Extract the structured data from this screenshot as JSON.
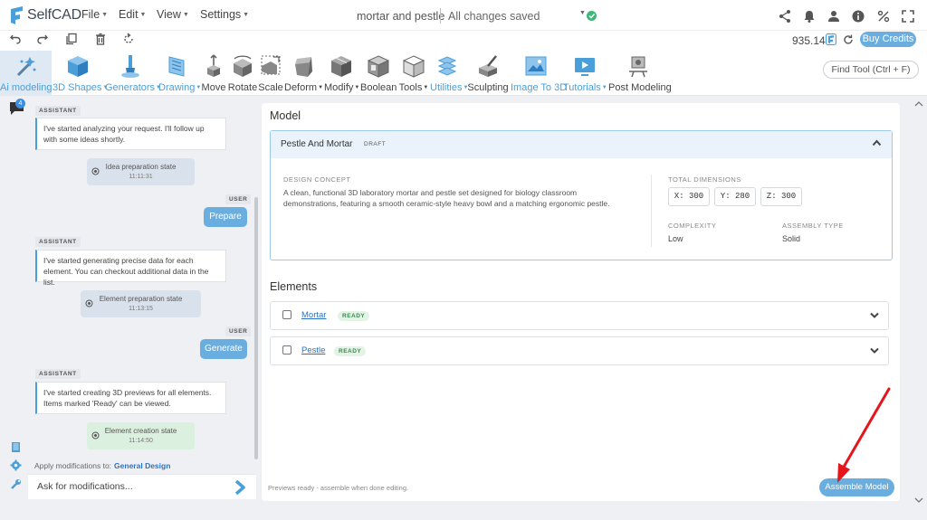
{
  "app": {
    "name": "SelfCAD"
  },
  "menu": {
    "file": "File",
    "edit": "Edit",
    "view": "View",
    "settings": "Settings"
  },
  "document": {
    "title": "mortar and pestle",
    "status": "All changes saved"
  },
  "account": {
    "credits": "935.14",
    "buy_label": "Buy Credits"
  },
  "toolbar": {
    "ai_modeling": "Ai modeling",
    "shapes_3d": "3D Shapes",
    "generators": "Generators",
    "drawing": "Drawing",
    "move": "Move",
    "rotate": "Rotate",
    "scale": "Scale",
    "deform": "Deform",
    "modify": "Modify",
    "boolean": "Boolean",
    "tools": "Tools",
    "utilities": "Utilities",
    "sculpting": "Sculpting",
    "image_to_3d": "Image To 3D",
    "tutorials": "Tutorials",
    "post_modeling": "Post Modeling",
    "find_tool": "Find Tool (Ctrl + F)"
  },
  "colors": {
    "accent": "#6aaee0",
    "brand_blue": "#4a9fd9",
    "link": "#2b73c2",
    "ready_green": "#3a8a4f"
  },
  "chat": {
    "badge_count": "4",
    "messages": [
      {
        "role": "ASSISTANT",
        "text": "I've started analyzing your request. I'll follow up with some ideas shortly."
      },
      {
        "state": "Idea preparation state",
        "time": "11:11:31"
      },
      {
        "role": "USER",
        "text": "Prepare"
      },
      {
        "role": "ASSISTANT",
        "text": "I've started generating precise data for each element. You can checkout additional data in the list."
      },
      {
        "state": "Element preparation state",
        "time": "11:13:15"
      },
      {
        "role": "USER",
        "text": "Generate"
      },
      {
        "role": "ASSISTANT",
        "text": "I've started creating 3D previews for all elements. Items marked 'Ready' can be viewed."
      },
      {
        "state": "Element creation state",
        "time": "11:14:50"
      }
    ],
    "apply_label": "Apply modifications to:",
    "apply_target": "General Design",
    "input_placeholder": "Ask for modifications..."
  },
  "model": {
    "heading": "Model",
    "name": "Pestle And Mortar",
    "status": "DRAFT",
    "design_concept_label": "DESIGN CONCEPT",
    "design_concept": "A clean, functional 3D laboratory mortar and pestle set designed for biology classroom demonstrations, featuring a smooth ceramic-style heavy bowl and a matching ergonomic pestle.",
    "dimensions_label": "TOTAL DIMENSIONS",
    "dim_x": "X: 300",
    "dim_y": "Y: 280",
    "dim_z": "Z: 300",
    "complexity_label": "COMPLEXITY",
    "complexity": "Low",
    "assembly_label": "ASSEMBLY TYPE",
    "assembly": "Solid"
  },
  "elements": {
    "heading": "Elements",
    "items": [
      {
        "name": "Mortar",
        "status": "READY"
      },
      {
        "name": "Pestle",
        "status": "READY"
      }
    ]
  },
  "footer": {
    "hint": "Previews ready - assemble when done editing.",
    "assemble_label": "Assemble Model"
  }
}
